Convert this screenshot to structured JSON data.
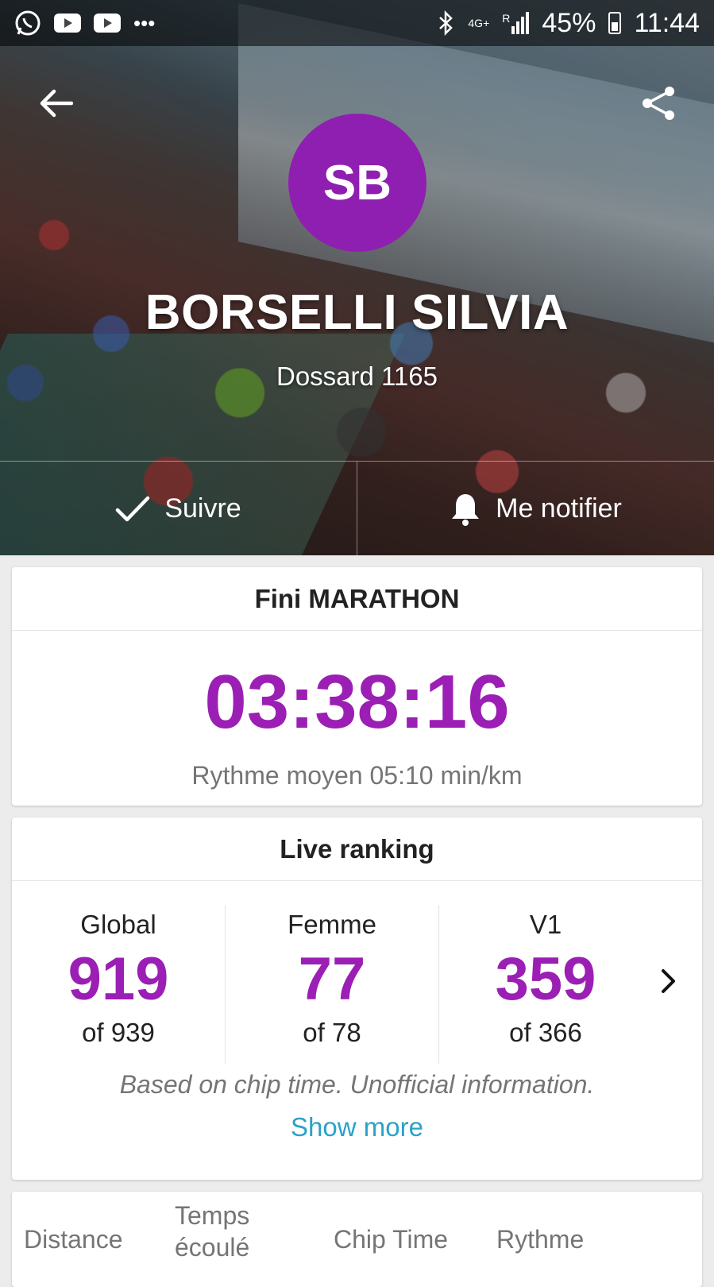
{
  "status_bar": {
    "battery": "45%",
    "time": "11:44",
    "network": "4G+",
    "roaming": "R"
  },
  "header": {
    "avatar_initials": "SB",
    "name": "BORSELLI SILVIA",
    "bib": "Dossard 1165",
    "follow_label": "Suivre",
    "notify_label": "Me notifier"
  },
  "finish": {
    "title": "Fini MARATHON",
    "time": "03:38:16",
    "pace": "Rythme moyen 05:10 min/km"
  },
  "ranking": {
    "title": "Live ranking",
    "items": [
      {
        "label": "Global",
        "value": "919",
        "total": "of 939"
      },
      {
        "label": "Femme",
        "value": "77",
        "total": "of 78"
      },
      {
        "label": "V1",
        "value": "359",
        "total": "of 366"
      }
    ],
    "note": "Based on chip time. Unofficial information.",
    "show_more": "Show more"
  },
  "splits": {
    "columns": [
      "Distance",
      "Temps\nécoulé",
      "Chip Time",
      "Rythme"
    ]
  },
  "colors": {
    "accent": "#9b1fb4",
    "link": "#2aa2c9",
    "avatar": "#8f1fb0"
  }
}
